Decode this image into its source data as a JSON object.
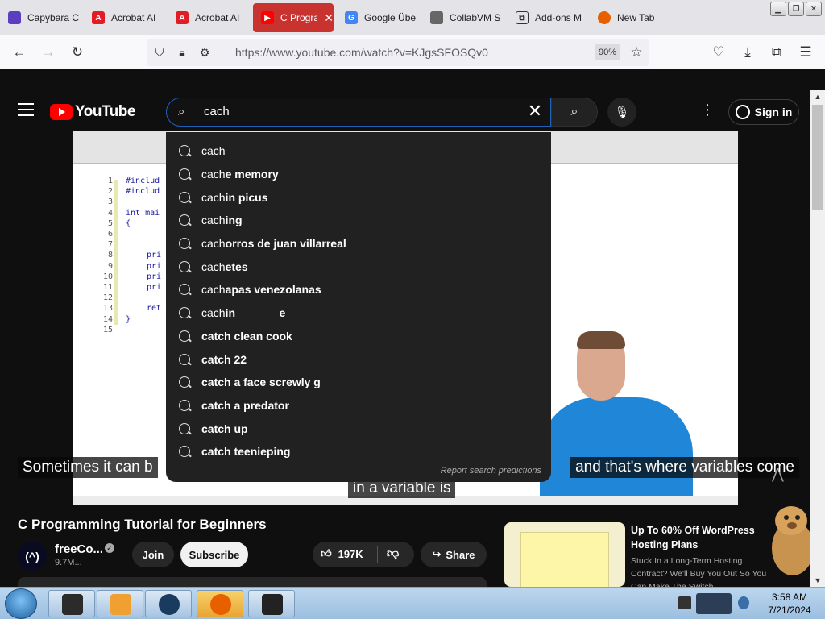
{
  "browser": {
    "tabs": [
      {
        "title": "Capybara C",
        "icon": "capybara-favicon",
        "color": "#5a3fc0"
      },
      {
        "title": "Acrobat AI",
        "icon": "acrobat-favicon",
        "color": "#e01d24"
      },
      {
        "title": "Acrobat AI",
        "icon": "acrobat-favicon",
        "color": "#e01d24"
      },
      {
        "title": "C Progra",
        "icon": "youtube-favicon",
        "color": "#ff0000",
        "active": true
      },
      {
        "title": "Google Übe",
        "icon": "google-translate-favicon",
        "color": "#4285f4"
      },
      {
        "title": "CollabVM S",
        "icon": "collabvm-favicon",
        "color": "#666666"
      },
      {
        "title": "Add-ons M",
        "icon": "puzzle-favicon",
        "color": "#333333"
      },
      {
        "title": "New Tab",
        "icon": "firefox-favicon",
        "color": "#e66000"
      }
    ],
    "close_glyph": "✕",
    "url": "https://www.youtube.com/watch?v=KJgsSFOSQv0",
    "zoom": "90%"
  },
  "youtube": {
    "logo_text": "YouTube",
    "search_value": "cach",
    "signin_label": "Sign in",
    "suggestions": [
      {
        "prefix": "cach",
        "rest": ""
      },
      {
        "prefix": "cach",
        "rest": "e memory"
      },
      {
        "prefix": "cach",
        "rest": "in picus"
      },
      {
        "prefix": "cach",
        "rest": "ing"
      },
      {
        "prefix": "cach",
        "rest": "orros de juan villarreal"
      },
      {
        "prefix": "cach",
        "rest": "etes"
      },
      {
        "prefix": "cach",
        "rest": "apas venezolanas"
      },
      {
        "prefix": "cach",
        "rest": "in              e"
      },
      {
        "prefix": "",
        "rest": "catch clean cook"
      },
      {
        "prefix": "",
        "rest": "catch 22"
      },
      {
        "prefix": "",
        "rest": "catch a face screwly g"
      },
      {
        "prefix": "",
        "rest": "catch a predator"
      },
      {
        "prefix": "",
        "rest": "catch up"
      },
      {
        "prefix": "",
        "rest": "catch teenieping"
      }
    ],
    "report_label": "Report search predictions"
  },
  "video": {
    "caption_left": "Sometimes it can b",
    "caption_right": "and that's where variables come",
    "caption_line2": "in a variable is",
    "code_lines": [
      "1",
      "2",
      "3",
      "4",
      "5",
      "6",
      "7",
      "8",
      "9",
      "10",
      "11",
      "12",
      "13",
      "14",
      "15"
    ],
    "code_text": [
      "#includ",
      "#includ",
      "",
      "int mai",
      "{",
      "",
      "",
      "pri",
      "pri",
      "pri",
      "pri",
      "",
      "ret",
      "}",
      ""
    ],
    "title": "C Programming Tutorial for Beginners",
    "channel_name": "freeCo...",
    "channel_logo": "(^)",
    "subscribers": "9.7M...",
    "join_label": "Join",
    "subscribe_label": "Subscribe",
    "likes": "197K",
    "share_label": "Share"
  },
  "ad": {
    "title": "Up To 60% Off WordPress Hosting Plans",
    "text": "Stuck In a Long-Term Hosting Contract? We'll Buy You Out So You Can Make The Switch"
  },
  "taskbar": {
    "time": "3:58 AM",
    "date": "7/21/2024"
  }
}
